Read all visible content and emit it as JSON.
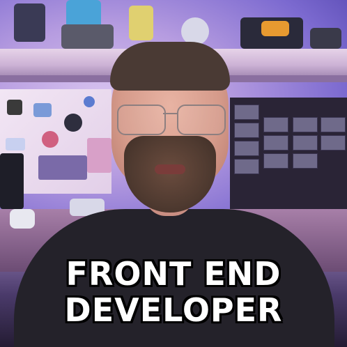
{
  "caption": {
    "line1": "FRONT END",
    "line2": "DEVELOPER"
  },
  "colors": {
    "caption_text": "#ffffff",
    "caption_outline": "#000000",
    "background_glow": "#b69ce0",
    "shirt": "#24222a"
  }
}
